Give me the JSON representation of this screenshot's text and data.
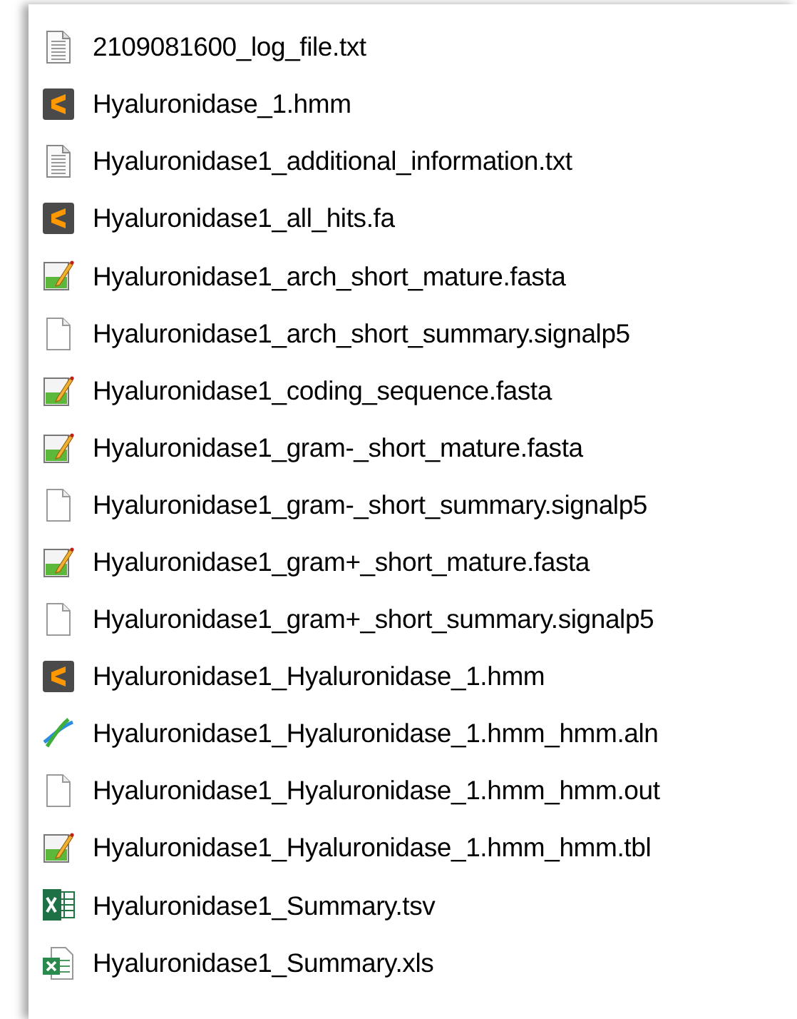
{
  "files": [
    {
      "name": "2109081600_log_file.txt",
      "kind": "text"
    },
    {
      "name": "Hyaluronidase_1.hmm",
      "kind": "sublime"
    },
    {
      "name": "Hyaluronidase1_additional_information.txt",
      "kind": "text"
    },
    {
      "name": "Hyaluronidase1_all_hits.fa",
      "kind": "sublime"
    },
    {
      "name": "Hyaluronidase1_arch_short_mature.fasta",
      "kind": "notepad"
    },
    {
      "name": "Hyaluronidase1_arch_short_summary.signalp5",
      "kind": "blank"
    },
    {
      "name": "Hyaluronidase1_coding_sequence.fasta",
      "kind": "notepad"
    },
    {
      "name": "Hyaluronidase1_gram-_short_mature.fasta",
      "kind": "notepad"
    },
    {
      "name": "Hyaluronidase1_gram-_short_summary.signalp5",
      "kind": "blank"
    },
    {
      "name": "Hyaluronidase1_gram+_short_mature.fasta",
      "kind": "notepad"
    },
    {
      "name": "Hyaluronidase1_gram+_short_summary.signalp5",
      "kind": "blank"
    },
    {
      "name": "Hyaluronidase1_Hyaluronidase_1.hmm",
      "kind": "sublime"
    },
    {
      "name": "Hyaluronidase1_Hyaluronidase_1.hmm_hmm.aln",
      "kind": "alignment"
    },
    {
      "name": "Hyaluronidase1_Hyaluronidase_1.hmm_hmm.out",
      "kind": "blank"
    },
    {
      "name": "Hyaluronidase1_Hyaluronidase_1.hmm_hmm.tbl",
      "kind": "notepad"
    },
    {
      "name": "Hyaluronidase1_Summary.tsv",
      "kind": "excel"
    },
    {
      "name": "Hyaluronidase1_Summary.xls",
      "kind": "excel-doc"
    }
  ]
}
